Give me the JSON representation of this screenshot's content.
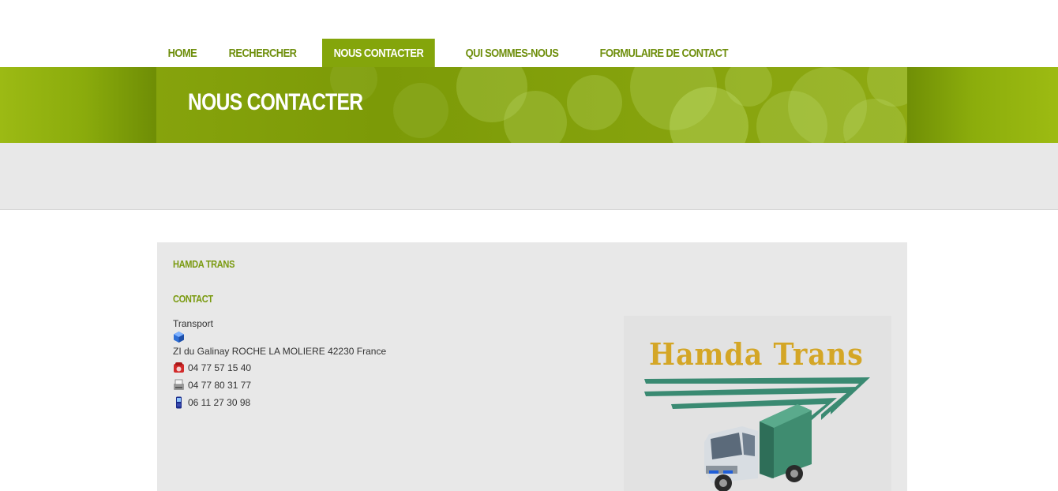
{
  "nav": {
    "items": [
      {
        "label": "HOME",
        "active": false
      },
      {
        "label": "RECHERCHER",
        "active": false
      },
      {
        "label": "NOUS CONTACTER",
        "active": true
      },
      {
        "label": "QUI SOMMES-NOUS",
        "active": false
      },
      {
        "label": "FORMULAIRE DE CONTACT",
        "active": false
      }
    ]
  },
  "banner": {
    "title": "NOUS CONTACTER"
  },
  "company": {
    "name": "HAMDA TRANS",
    "contact_heading": "CONTACT",
    "activity": "Transport",
    "address": "ZI du Galinay ROCHE LA MOLIERE 42230 France",
    "phone": "04 77 57 15 40",
    "fax": "04 77 80 31 77",
    "mobile": "06 11 27 30 98"
  },
  "logo": {
    "text": "Hamda Trans"
  },
  "colors": {
    "accent_green": "#84a50b",
    "nav_text": "#6e8e0c",
    "logo_gold": "#d4a626",
    "truck_green": "#3a8a72"
  }
}
